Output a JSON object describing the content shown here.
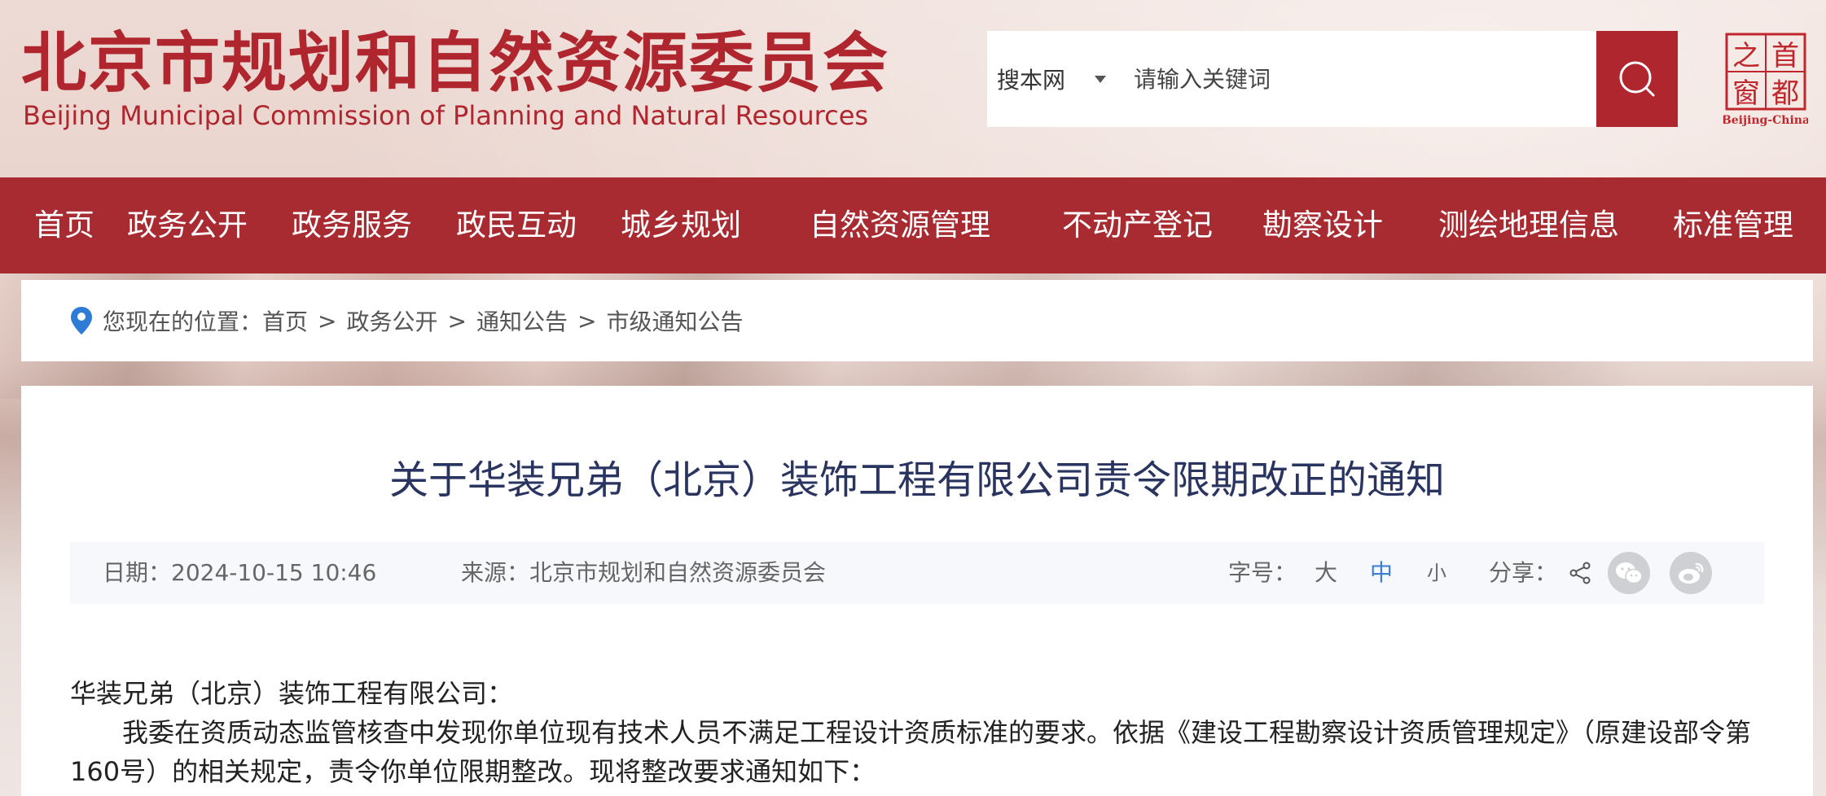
{
  "header": {
    "title_cn": "北京市规划和自然资源委员会",
    "title_en": "Beijing Municipal Commission of Planning and Natural Resources",
    "search": {
      "scope": "搜本网",
      "placeholder": "请输入关键词"
    },
    "capital_logo": {
      "chars": "首都之窗",
      "caption": "Beijing-China"
    }
  },
  "nav": {
    "items": [
      {
        "label": "首页"
      },
      {
        "label": "政务公开"
      },
      {
        "label": "政务服务"
      },
      {
        "label": "政民互动"
      },
      {
        "label": "城乡规划"
      },
      {
        "label": "自然资源管理"
      },
      {
        "label": "不动产登记"
      },
      {
        "label": "勘察设计"
      },
      {
        "label": "测绘地理信息"
      },
      {
        "label": "标准管理"
      }
    ]
  },
  "breadcrumb": {
    "prefix": "您现在的位置：",
    "items": [
      "首页",
      "政务公开",
      "通知公告",
      "市级通知公告"
    ],
    "separator": ">"
  },
  "article": {
    "title": "关于华装兄弟（北京）装饰工程有限公司责令限期改正的通知",
    "date": "日期：2024-10-15 10:46",
    "source": "来源：北京市规划和自然资源委员会",
    "font_size_label": "字号：",
    "font_sizes": [
      "大",
      "中",
      "小"
    ],
    "active_font_size": "中",
    "share_label": "分享：",
    "body": {
      "salutation": "华装兄弟（北京）装饰工程有限公司：",
      "paragraph_line1": "我委在资质动态监管核查中发现你单位现有技术人员不满足工程设计资质标准的要求。依据《建设工程勘察设计资质管理规定》（原建设部令第",
      "paragraph_line2": "160号）的相关规定，责令你单位限期整改。现将整改要求通知如下："
    }
  },
  "colors": {
    "brand_red": "#b0262e",
    "nav_red": "#a92b32",
    "title_navy": "#2a3460",
    "active_blue": "#3b7dd8"
  }
}
